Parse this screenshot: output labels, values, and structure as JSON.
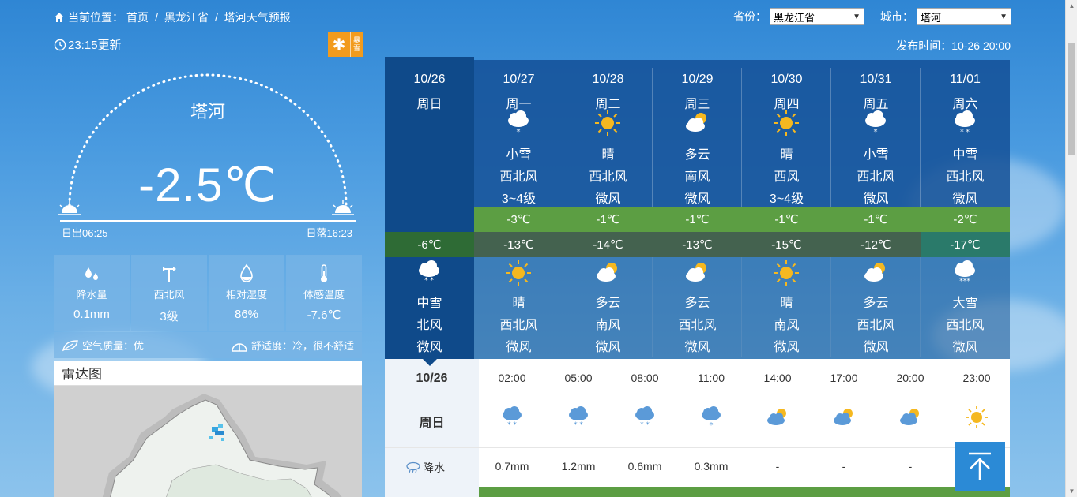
{
  "breadcrumb": {
    "prefix": "当前位置：",
    "items": [
      "首页",
      "黑龙江省",
      "塔河天气预报"
    ],
    "separator": "/"
  },
  "selectors": {
    "province_label": "省份：",
    "province_value": "黑龙江省",
    "city_label": "城市：",
    "city_value": "塔河"
  },
  "update_time": "23:15更新",
  "warning_badge": {
    "symbol": "✱",
    "text_top": "暴",
    "text_bottom": "雪"
  },
  "publish_time": "发布时间：10-26 20:00",
  "current": {
    "city": "塔河",
    "temperature": "-2.5℃",
    "sunrise": "日出06:25",
    "sunset": "日落16:23"
  },
  "stats": [
    {
      "icon": "raindrops-icon",
      "label": "降水量",
      "value": "0.1mm"
    },
    {
      "icon": "wind-vane-icon",
      "label": "西北风",
      "value": "3级"
    },
    {
      "icon": "humidity-drop-icon",
      "label": "相对湿度",
      "value": "86%"
    },
    {
      "icon": "thermometer-icon",
      "label": "体感温度",
      "value": "-7.6℃"
    }
  ],
  "air_quality": "空气质量：优",
  "comfort": "舒适度：冷，很不舒适",
  "radar_title": "雷达图",
  "days": [
    {
      "date": "10/26",
      "weekday": "周日",
      "day_icon": "",
      "day_weather": "",
      "day_wind": "",
      "day_wind_level": "",
      "high": "",
      "low": "-6℃",
      "night_icon": "moderate-snow",
      "night_weather": "中雪",
      "night_wind": "北风",
      "night_wind_level": "微风"
    },
    {
      "date": "10/27",
      "weekday": "周一",
      "day_icon": "light-snow",
      "day_weather": "小雪",
      "day_wind": "西北风",
      "day_wind_level": "3~4级",
      "high": "-3℃",
      "low": "-13℃",
      "night_icon": "sunny",
      "night_weather": "晴",
      "night_wind": "西北风",
      "night_wind_level": "微风"
    },
    {
      "date": "10/28",
      "weekday": "周二",
      "day_icon": "sunny",
      "day_weather": "晴",
      "day_wind": "西北风",
      "day_wind_level": "微风",
      "high": "-1℃",
      "low": "-14℃",
      "night_icon": "cloudy",
      "night_weather": "多云",
      "night_wind": "南风",
      "night_wind_level": "微风"
    },
    {
      "date": "10/29",
      "weekday": "周三",
      "day_icon": "cloudy",
      "day_weather": "多云",
      "day_wind": "南风",
      "day_wind_level": "微风",
      "high": "-1℃",
      "low": "-13℃",
      "night_icon": "cloudy",
      "night_weather": "多云",
      "night_wind": "西北风",
      "night_wind_level": "微风"
    },
    {
      "date": "10/30",
      "weekday": "周四",
      "day_icon": "sunny",
      "day_weather": "晴",
      "day_wind": "西风",
      "day_wind_level": "3~4级",
      "high": "-1℃",
      "low": "-15℃",
      "night_icon": "sunny",
      "night_weather": "晴",
      "night_wind": "南风",
      "night_wind_level": "微风"
    },
    {
      "date": "10/31",
      "weekday": "周五",
      "day_icon": "light-snow",
      "day_weather": "小雪",
      "day_wind": "西北风",
      "day_wind_level": "微风",
      "high": "-1℃",
      "low": "-12℃",
      "night_icon": "cloudy",
      "night_weather": "多云",
      "night_wind": "西北风",
      "night_wind_level": "微风"
    },
    {
      "date": "11/01",
      "weekday": "周六",
      "day_icon": "moderate-snow",
      "day_weather": "中雪",
      "day_wind": "西北风",
      "day_wind_level": "微风",
      "high": "-2℃",
      "low": "-17℃",
      "night_icon": "heavy-snow",
      "night_weather": "大雪",
      "night_wind": "西北风",
      "night_wind_level": "微风"
    }
  ],
  "hourly": {
    "date": "10/26",
    "weekday": "周日",
    "precip_label": "降水",
    "slots": [
      {
        "time": "02:00",
        "icon": "moderate-snow",
        "precip": "0.7mm"
      },
      {
        "time": "05:00",
        "icon": "moderate-snow",
        "precip": "1.2mm"
      },
      {
        "time": "08:00",
        "icon": "moderate-snow",
        "precip": "0.6mm"
      },
      {
        "time": "11:00",
        "icon": "light-snow",
        "precip": "0.3mm"
      },
      {
        "time": "14:00",
        "icon": "cloudy",
        "precip": "-"
      },
      {
        "time": "17:00",
        "icon": "cloudy",
        "precip": "-"
      },
      {
        "time": "20:00",
        "icon": "cloudy",
        "precip": "-"
      },
      {
        "time": "23:00",
        "icon": "sunny",
        "precip": ""
      }
    ]
  },
  "colors": {
    "high_temp_bar": "#5c9e43",
    "today_column": "#0f4a8a",
    "back_to_top": "#2b8ad6",
    "warning_badge": "#f29b1d"
  }
}
